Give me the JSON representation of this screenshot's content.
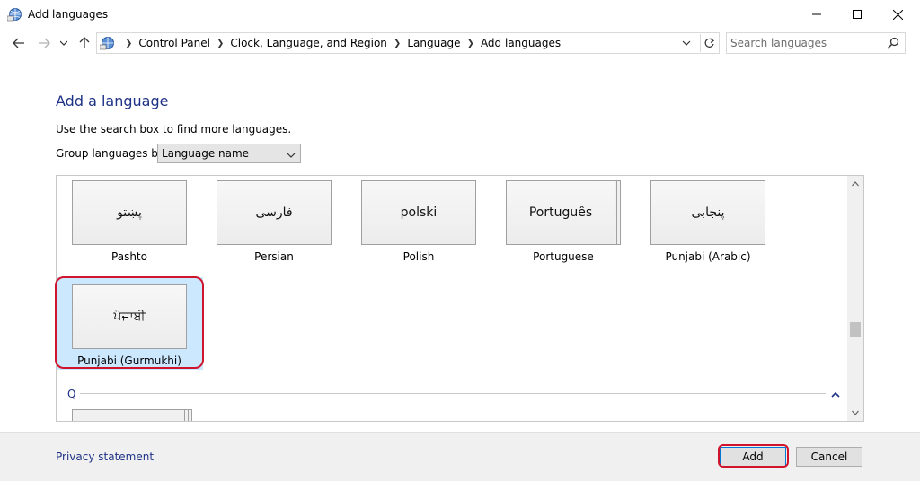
{
  "window": {
    "title": "Add languages"
  },
  "address": {
    "crumbs": [
      "Control Panel",
      "Clock, Language, and Region",
      "Language",
      "Add languages"
    ]
  },
  "search": {
    "placeholder": "Search languages"
  },
  "main": {
    "heading": "Add a language",
    "hint": "Use the search box to find more languages.",
    "group_label": "Group languages by:",
    "group_value": "Language name"
  },
  "languages": [
    {
      "native": "پښتو",
      "name": "Pashto",
      "stacked": false
    },
    {
      "native": "فارسی",
      "name": "Persian",
      "stacked": false
    },
    {
      "native": "polski",
      "name": "Polish",
      "stacked": false
    },
    {
      "native": "Português",
      "name": "Portuguese",
      "stacked": true
    },
    {
      "native": "پنجابی",
      "name": "Punjabi (Arabic)",
      "stacked": false
    },
    {
      "native": "ਪੰਜਾਬੀ",
      "name": "Punjabi (Gurmukhi)",
      "stacked": false,
      "selected": true
    }
  ],
  "section": {
    "letter": "Q"
  },
  "footer": {
    "privacy": "Privacy statement",
    "add": "Add",
    "cancel": "Cancel"
  },
  "colors": {
    "highlight": "#d0142c",
    "selection": "#cce8ff",
    "link": "#1e3287"
  }
}
